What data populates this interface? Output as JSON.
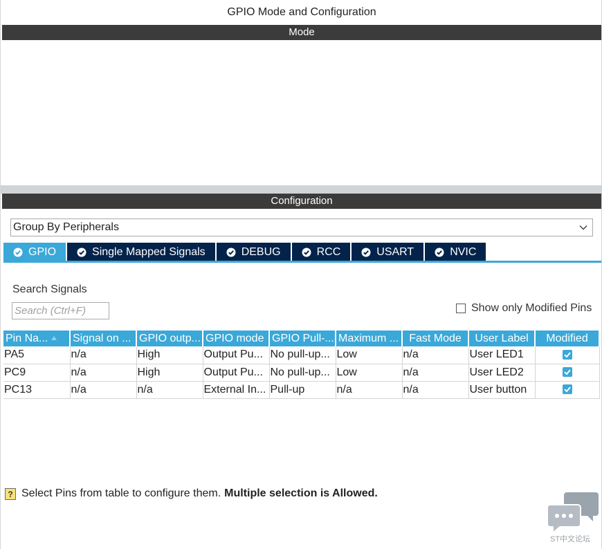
{
  "window": {
    "title": "GPIO Mode and Configuration"
  },
  "mode_section": {
    "header": "Mode"
  },
  "config_section": {
    "header": "Configuration",
    "group_by": {
      "selected": "Group By Peripherals"
    },
    "tabs": [
      {
        "label": "GPIO",
        "active": true
      },
      {
        "label": "Single Mapped Signals",
        "active": false
      },
      {
        "label": "DEBUG",
        "active": false
      },
      {
        "label": "RCC",
        "active": false
      },
      {
        "label": "USART",
        "active": false
      },
      {
        "label": "NVIC",
        "active": false
      }
    ],
    "search": {
      "label": "Search Signals",
      "placeholder": "Search (Ctrl+F)"
    },
    "show_modified": {
      "label": "Show only Modified Pins",
      "checked": false
    },
    "table": {
      "columns": [
        "Pin Na...",
        "Signal on ...",
        "GPIO outp...",
        "GPIO mode",
        "GPIO Pull-...",
        "Maximum ...",
        "Fast Mode",
        "User Label",
        "Modified"
      ],
      "rows": [
        {
          "pin": "PA5",
          "signal": "n/a",
          "output": "High",
          "mode": "Output Pu...",
          "pull": "No pull-up...",
          "max": "Low",
          "fast": "n/a",
          "label": "User LED1",
          "modified": true
        },
        {
          "pin": "PC9",
          "signal": "n/a",
          "output": "High",
          "mode": "Output Pu...",
          "pull": "No pull-up...",
          "max": "Low",
          "fast": "n/a",
          "label": "User LED2",
          "modified": true
        },
        {
          "pin": "PC13",
          "signal": "n/a",
          "output": "n/a",
          "mode": "External In...",
          "pull": "Pull-up",
          "max": "n/a",
          "fast": "n/a",
          "label": "User button",
          "modified": true
        }
      ]
    },
    "hint": {
      "text": "Select Pins from table to configure them.",
      "bold": "Multiple selection is Allowed."
    }
  },
  "watermark": {
    "text": "ST中文论坛"
  },
  "colors": {
    "header_dark": "#3b3b3b",
    "tab_navy": "#03234b",
    "accent_blue": "#3aa8d8"
  },
  "icons": {
    "tab_status": "check-circle-icon",
    "sort": "sort-ascending-icon",
    "dropdown": "chevron-down-icon",
    "hint": "question-help-icon",
    "watermark": "chat-bubbles-icon"
  }
}
